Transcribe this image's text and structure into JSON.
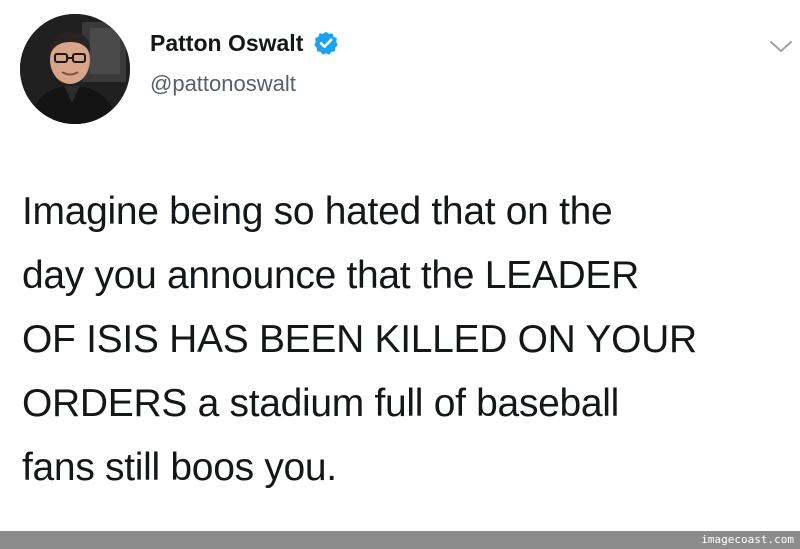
{
  "tweet": {
    "author": {
      "display_name": "Patton Oswalt",
      "handle": "@pattonoswalt",
      "verified": true,
      "avatar_icon": "person-avatar-icon"
    },
    "text_lines": [
      "Imagine being so hated that on the",
      "day you announce that the LEADER",
      "OF ISIS HAS BEEN KILLED ON YOUR",
      "ORDERS a stadium full of baseball",
      "fans still boos you."
    ],
    "menu_icon": "chevron-down-icon"
  },
  "watermark": {
    "text": "imagecoast.com"
  },
  "colors": {
    "verified_badge": "#1da1f2",
    "text_primary": "#14171a",
    "text_secondary": "#57606a",
    "watermark_bar": "#8c8c8c"
  }
}
